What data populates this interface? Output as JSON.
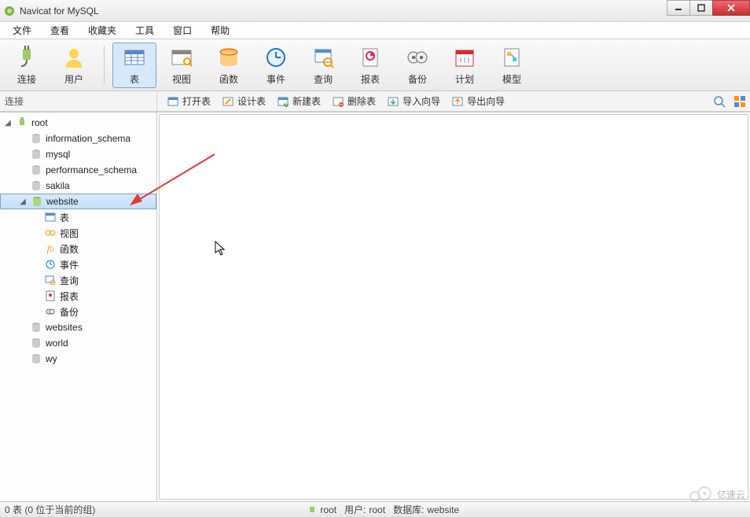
{
  "window": {
    "title": "Navicat for MySQL"
  },
  "menu": {
    "items": [
      "文件",
      "查看",
      "收藏夹",
      "工具",
      "窗口",
      "帮助"
    ]
  },
  "toolbar": {
    "buttons": [
      {
        "label": "连接",
        "icon": "plug"
      },
      {
        "label": "用户",
        "icon": "user"
      },
      {
        "label": "表",
        "icon": "table",
        "active": true
      },
      {
        "label": "视图",
        "icon": "view"
      },
      {
        "label": "函数",
        "icon": "function"
      },
      {
        "label": "事件",
        "icon": "event"
      },
      {
        "label": "查询",
        "icon": "query"
      },
      {
        "label": "报表",
        "icon": "report"
      },
      {
        "label": "备份",
        "icon": "backup"
      },
      {
        "label": "计划",
        "icon": "schedule"
      },
      {
        "label": "模型",
        "icon": "model"
      }
    ]
  },
  "sub": {
    "connection_label": "连接",
    "buttons": [
      {
        "label": "打开表",
        "icon": "open"
      },
      {
        "label": "设计表",
        "icon": "design"
      },
      {
        "label": "新建表",
        "icon": "new"
      },
      {
        "label": "删除表",
        "icon": "delete"
      },
      {
        "label": "导入向导",
        "icon": "import"
      },
      {
        "label": "导出向导",
        "icon": "export"
      }
    ]
  },
  "tree": {
    "root": {
      "label": "root",
      "expanded": true,
      "icon": "connection"
    },
    "databases": [
      {
        "label": "information_schema",
        "icon": "db-off"
      },
      {
        "label": "mysql",
        "icon": "db-off"
      },
      {
        "label": "performance_schema",
        "icon": "db-off"
      },
      {
        "label": "sakila",
        "icon": "db-off"
      },
      {
        "label": "website",
        "icon": "db-on",
        "selected": true,
        "expanded": true
      },
      {
        "label": "websites",
        "icon": "db-off"
      },
      {
        "label": "world",
        "icon": "db-off"
      },
      {
        "label": "wy",
        "icon": "db-off"
      }
    ],
    "website_children": [
      {
        "label": "表",
        "icon": "tables"
      },
      {
        "label": "视图",
        "icon": "views"
      },
      {
        "label": "函数",
        "icon": "functions"
      },
      {
        "label": "事件",
        "icon": "events"
      },
      {
        "label": "查询",
        "icon": "queries"
      },
      {
        "label": "报表",
        "icon": "reports"
      },
      {
        "label": "备份",
        "icon": "backups"
      }
    ]
  },
  "status": {
    "left": "0 表 (0 位于当前的组)",
    "conn": "root",
    "user_label": "用户:",
    "user": "root",
    "db_label": "数据库:",
    "db": "website"
  },
  "watermark": "亿速云"
}
